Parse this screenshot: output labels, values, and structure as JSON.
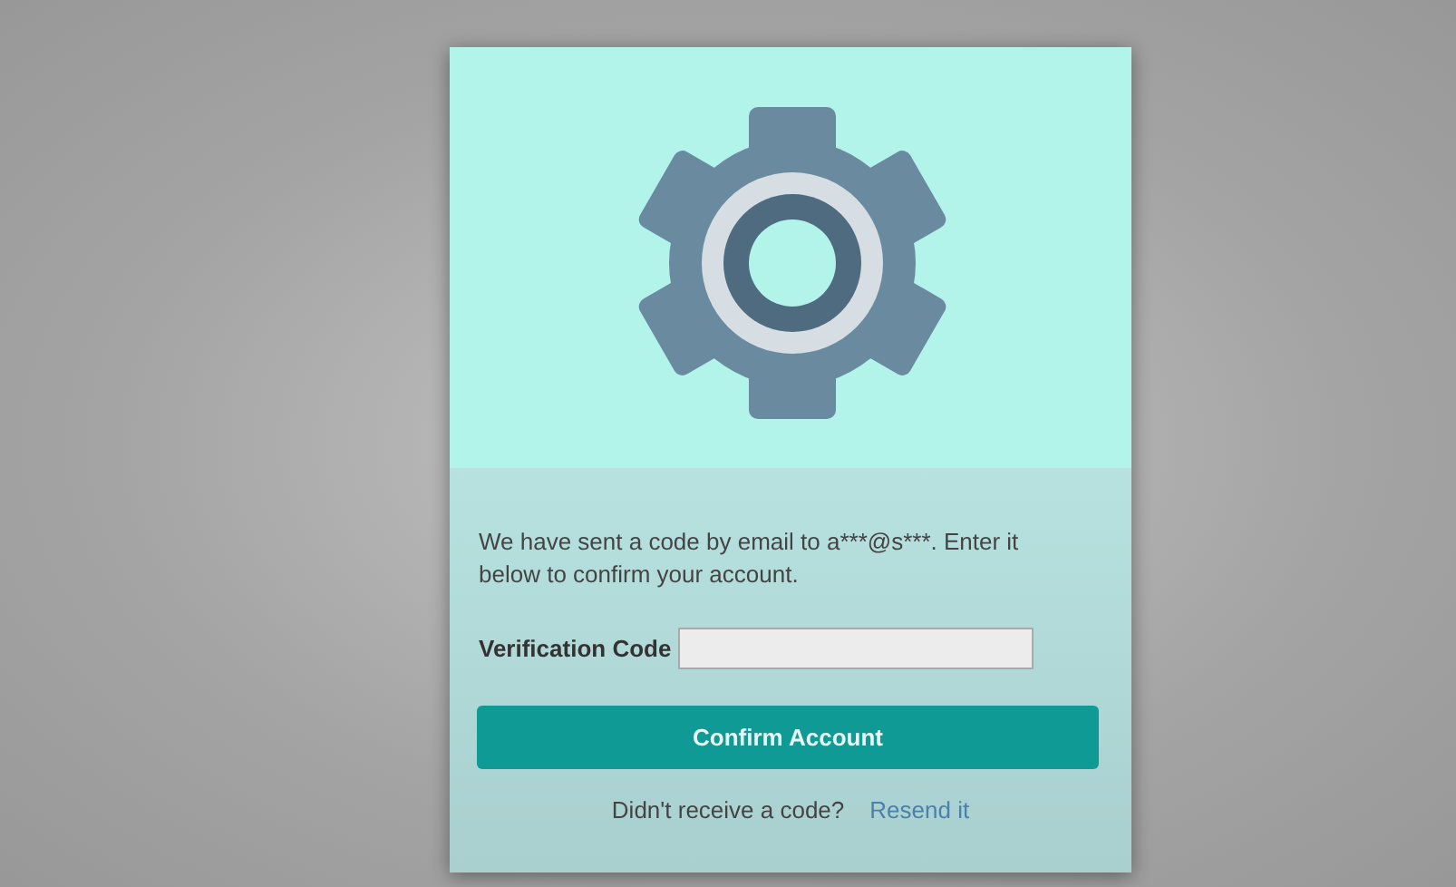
{
  "message": "We have sent a code by email to a***@s***. Enter it below to confirm your account.",
  "verification_code": {
    "label": "Verification Code"
  },
  "confirm_button": "Confirm Account",
  "footer": {
    "text": "Didn't receive a code?",
    "link": "Resend it"
  }
}
